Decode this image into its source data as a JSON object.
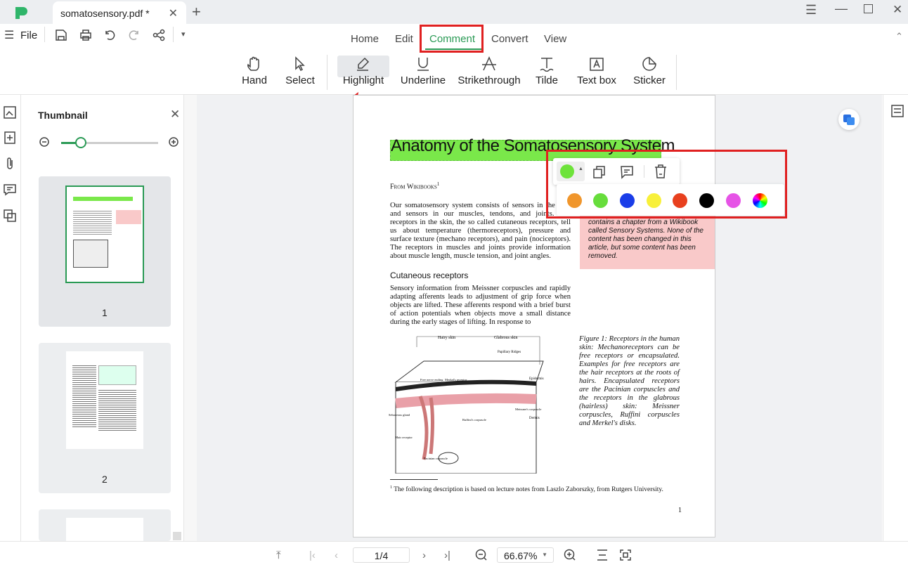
{
  "tab": {
    "title": "somatosensory.pdf *"
  },
  "menu": {
    "file": "File",
    "tabs": [
      "Home",
      "Edit",
      "Comment",
      "Convert",
      "View"
    ],
    "active": "Comment"
  },
  "tools": [
    "Hand",
    "Select",
    "Highlight",
    "Underline",
    "Strikethrough",
    "Tilde",
    "Text box",
    "Sticker"
  ],
  "active_tool": "Highlight",
  "sidebar": {
    "title": "Thumbnail",
    "pages": [
      "1",
      "2"
    ]
  },
  "popup": {
    "selected_color": "#6ee33a",
    "colors": [
      "#f0962c",
      "#67dd3c",
      "#1a3de8",
      "#f8f03a",
      "#e8401e",
      "#000000",
      "#e653e6",
      "rainbow"
    ]
  },
  "document": {
    "title": "Anatomy of the Somatosensory System",
    "from": "From Wikibooks",
    "from_sup": "1",
    "para1": "Our somatosensory system consists of sensors in the skin and sensors in our muscles, tendons, and joints. The receptors in the skin, the so called cutaneous receptors, tell us about temperature (thermoreceptors), pressure and surface texture (mechano receptors), and pain (nociceptors). The receptors in muscles and joints provide information about muscle length, muscle tension, and joint angles.",
    "heading": "Cutaneous receptors",
    "para2": "Sensory information from Meissner corpuscles and rapidly adapting afferents leads to adjustment of grip force when objects are lifted. These afferents respond with a brief burst of action potentials when objects move a small distance during the early stages of lifting. In response to",
    "note": "contains a chapter from a Wikibook called Sensory Systems. None of the content has been changed in this article, but some content has been removed.",
    "figure_caption": "Figure 1: Receptors in the human skin: Mechanoreceptors can be free receptors or encapsulated. Examples for free receptors are the hair receptors at the roots of hairs. Encapsulated receptors are the Pacinian corpuscles and the receptors in the glabrous (hairless) skin: Meissner corpuscles, Ruffini corpuscles and Merkel's disks.",
    "figure_labels": [
      "Hairy skin",
      "Glabrous skin",
      "Papillary Ridges",
      "Epidermis",
      "Dermis",
      "Free nerve ending",
      "Merkel's receptor",
      "Meissner's corpuscle",
      "Ruffini's corpuscle",
      "Hair receptor",
      "Pacinian corpuscle",
      "Sebaceous gland"
    ],
    "footnote": "The following description is based on lecture notes from Laszlo Zaborszky, from Rutgers University.",
    "footnote_mark": "1",
    "page_number": "1"
  },
  "bottom": {
    "page": "1/4",
    "zoom": "66.67%"
  },
  "colors": {
    "highlight": "#7ae84a",
    "annotation_box": "#e02020",
    "note_bg": "#f9c9c9"
  }
}
